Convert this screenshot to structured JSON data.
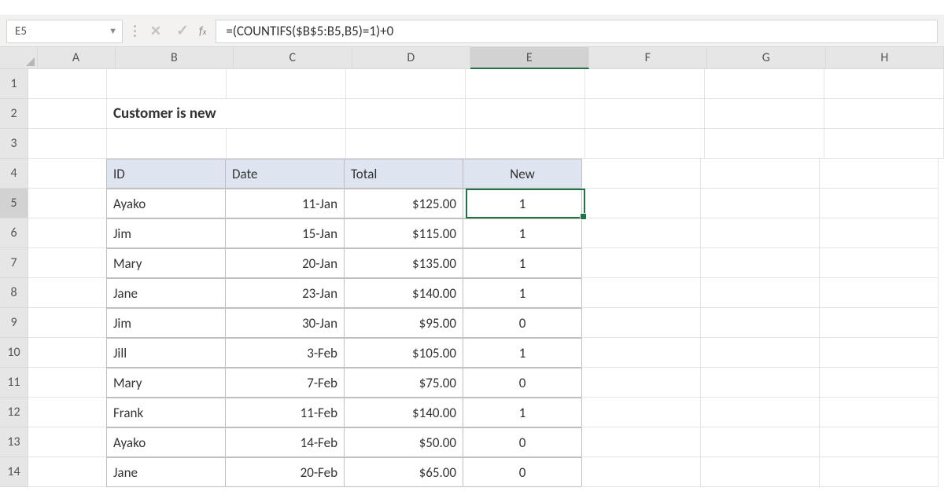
{
  "nameBox": "E5",
  "formula": "=(COUNTIFS($B$5:B5,B5)=1)+0",
  "columns": [
    "A",
    "B",
    "C",
    "D",
    "E",
    "F",
    "G",
    "H"
  ],
  "selectedColumn": "E",
  "rows": [
    1,
    2,
    3,
    4,
    5,
    6,
    7,
    8,
    9,
    10,
    11,
    12,
    13,
    14
  ],
  "selectedRow": 5,
  "title": "Customer is new",
  "headers": {
    "id": "ID",
    "date": "Date",
    "total": "Total",
    "new": "New"
  },
  "data": [
    {
      "id": "Ayako",
      "date": "11-Jan",
      "total": "$125.00",
      "new": "1"
    },
    {
      "id": "Jim",
      "date": "15-Jan",
      "total": "$115.00",
      "new": "1"
    },
    {
      "id": "Mary",
      "date": "20-Jan",
      "total": "$135.00",
      "new": "1"
    },
    {
      "id": "Jane",
      "date": "23-Jan",
      "total": "$140.00",
      "new": "1"
    },
    {
      "id": "Jim",
      "date": "30-Jan",
      "total": "$95.00",
      "new": "0"
    },
    {
      "id": "Jill",
      "date": "3-Feb",
      "total": "$105.00",
      "new": "1"
    },
    {
      "id": "Mary",
      "date": "7-Feb",
      "total": "$75.00",
      "new": "0"
    },
    {
      "id": "Frank",
      "date": "11-Feb",
      "total": "$140.00",
      "new": "1"
    },
    {
      "id": "Ayako",
      "date": "14-Feb",
      "total": "$50.00",
      "new": "0"
    },
    {
      "id": "Jane",
      "date": "20-Feb",
      "total": "$65.00",
      "new": "0"
    }
  ]
}
